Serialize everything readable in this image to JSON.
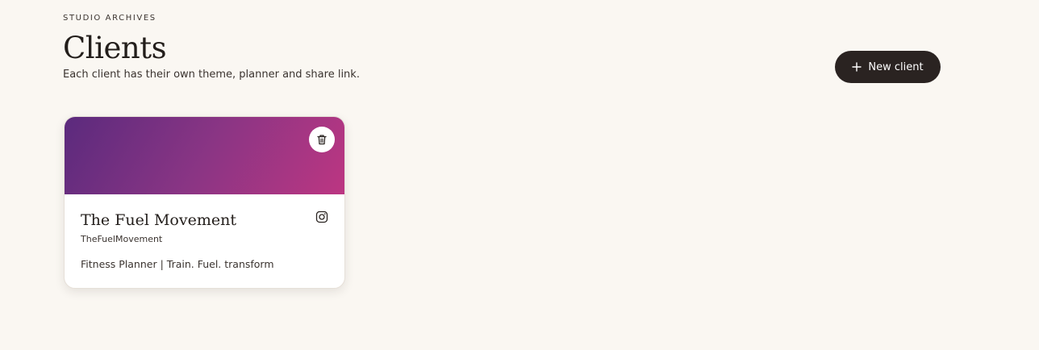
{
  "header": {
    "eyebrow": "STUDIO ARCHIVES",
    "title": "Clients",
    "subtitle": "Each client has their own theme, planner and share link.",
    "new_client_label": "New client"
  },
  "icons": {
    "new_client": "plus-icon",
    "delete": "trash-icon",
    "social": "instagram-icon"
  },
  "colors": {
    "background": "#faf7f2",
    "button_bg": "#2a2321",
    "cover_gradient_start": "#5b2a7d",
    "cover_gradient_end": "#bc3682"
  },
  "clients": [
    {
      "name": "The Fuel Movement",
      "handle": "TheFuelMovement",
      "description": "Fitness Planner | Train. Fuel. transform"
    }
  ]
}
